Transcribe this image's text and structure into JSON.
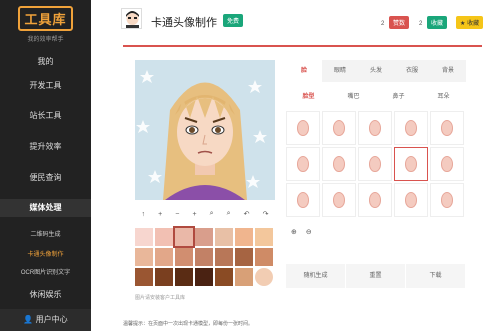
{
  "sidebar": {
    "logo_text": "工具库",
    "logo_sub": "我的效率帮手",
    "items": [
      {
        "label": "我的"
      },
      {
        "label": "开发工具"
      },
      {
        "label": "站长工具"
      },
      {
        "label": "提升效率"
      },
      {
        "label": "便民查询"
      },
      {
        "label": "媒体处理"
      }
    ],
    "sub_items": [
      {
        "label": "二维码生成"
      },
      {
        "label": "卡通头像制作"
      },
      {
        "label": "OCR图片识别文字"
      }
    ],
    "more": "休闲娱乐",
    "user_center": "用户中心"
  },
  "header": {
    "title": "卡通头像制作",
    "free_badge": "免费",
    "stat1_count": "2",
    "stat1_label": "赞数",
    "stat2_count": "2",
    "stat2_label": "收藏",
    "fav_label": "收藏"
  },
  "tabs": [
    "脸",
    "眼睛",
    "头发",
    "衣服",
    "背景"
  ],
  "subtabs": [
    "脸型",
    "嘴巴",
    "鼻子",
    "耳朵"
  ],
  "face_options_count": 15,
  "selected_face_index": 8,
  "tools": [
    "↑",
    "+",
    "−",
    "+",
    "⌕",
    "⌕",
    "↶",
    "↷"
  ],
  "swatches": [
    "#f7d6cf",
    "#f2c0b3",
    "#eab8a8",
    "#d99e8c",
    "#e8c0a6",
    "#f0b58e",
    "#f3c79c",
    "#e9b79a",
    "#e2a789",
    "#d18e70",
    "#c28166",
    "#b87758",
    "#a66442",
    "#cf8b66",
    "#9a5632",
    "#7a3f1f",
    "#5a2c14",
    "#4a2212",
    "#8a4b24",
    "#d8a077",
    "#f2cdb3"
  ],
  "caption": "图片请安装客户工具库",
  "actions": [
    "随机生成",
    "重置",
    "下载"
  ],
  "footer": "温馨提示：在页面中一次出现卡通模型，即每份一张时间。",
  "colors": {
    "accent": "#d9534f",
    "sidebar": "#222222",
    "brand": "#f0a23a",
    "green": "#1aa67a"
  }
}
